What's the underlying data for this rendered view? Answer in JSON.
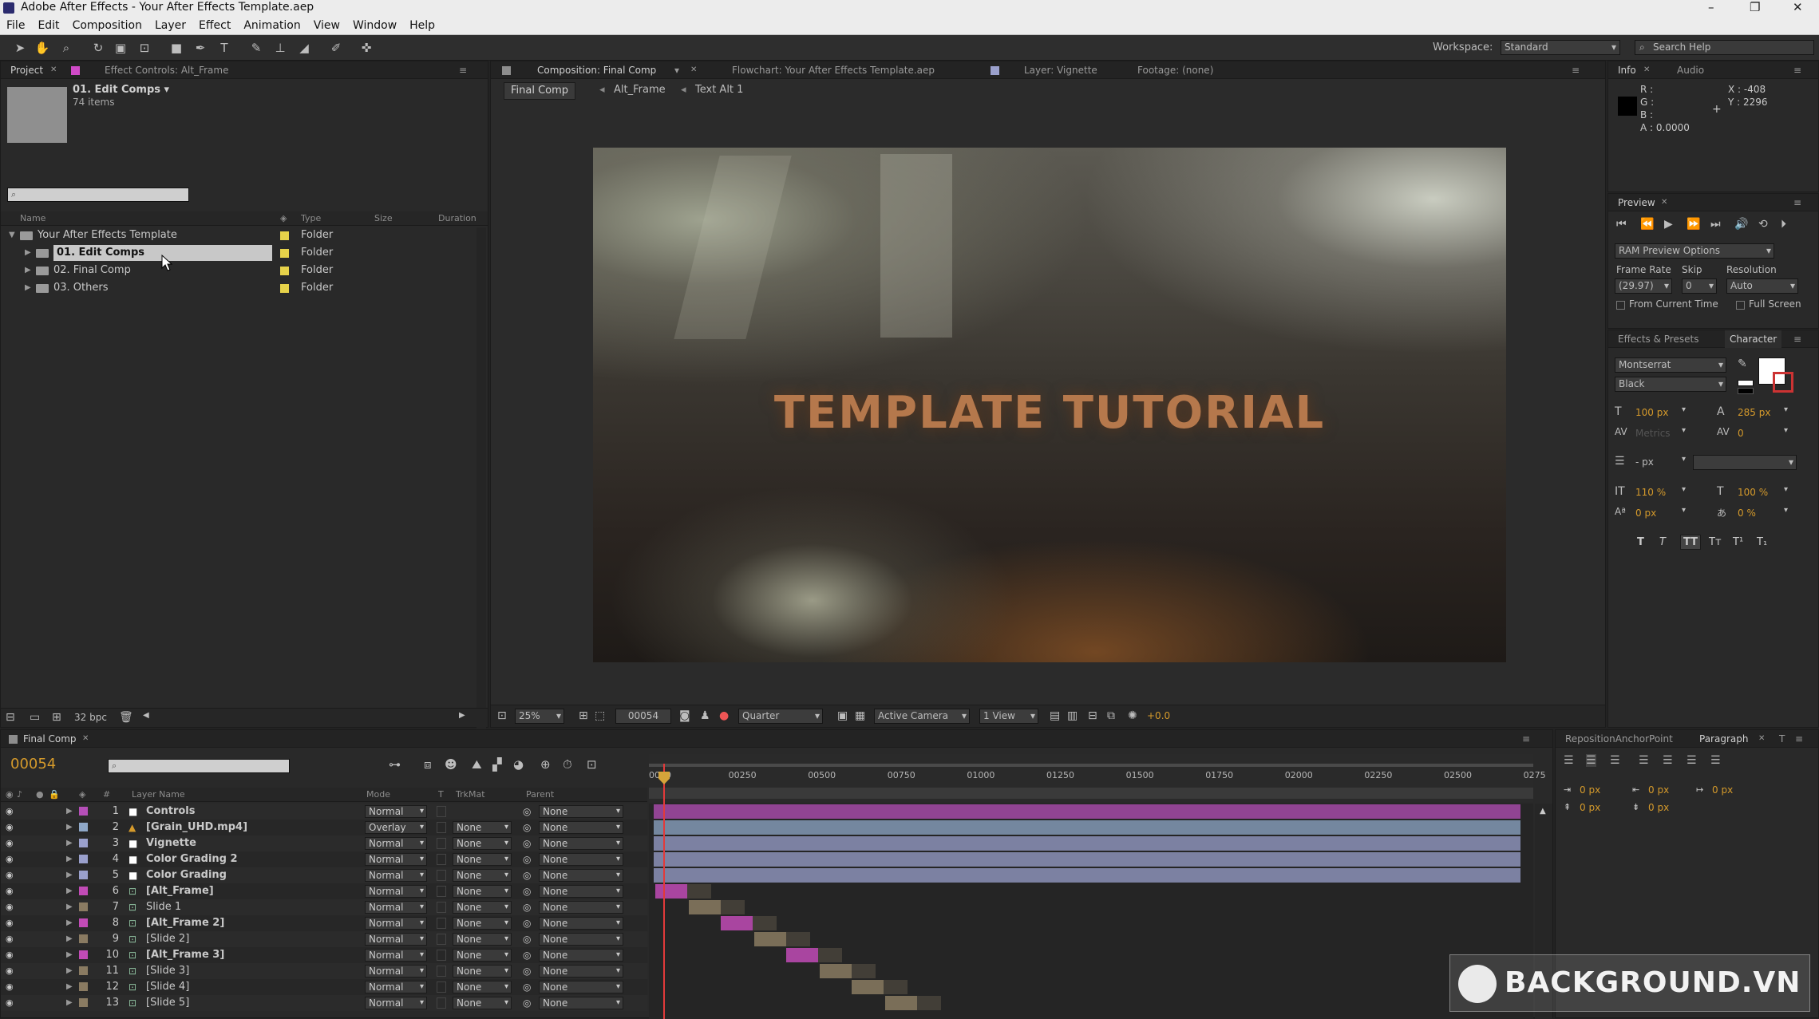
{
  "window": {
    "title": "Adobe After Effects - Your After Effects Template.aep",
    "minimize": "–",
    "maximize": "❐",
    "close": "✕"
  },
  "menu": [
    "File",
    "Edit",
    "Composition",
    "Layer",
    "Effect",
    "Animation",
    "View",
    "Window",
    "Help"
  ],
  "workspace": {
    "label": "Workspace:",
    "value": "Standard",
    "search_placeholder": "Search Help"
  },
  "project_panel": {
    "tab_project": "Project",
    "tab_effect_controls": "Effect Controls: Alt_Frame",
    "selected_name": "01. Edit Comps ▾",
    "selected_count": "74 items",
    "columns": [
      "Name",
      "Type",
      "Size",
      "Duration"
    ],
    "items": [
      {
        "name": "Your After Effects Template",
        "type": "Folder",
        "indent": 0,
        "color": "#e6d24a",
        "open": true
      },
      {
        "name": "01. Edit Comps",
        "type": "Folder",
        "indent": 1,
        "color": "#e6d24a",
        "selected": true
      },
      {
        "name": "02. Final Comp",
        "type": "Folder",
        "indent": 1,
        "color": "#e6d24a"
      },
      {
        "name": "03. Others",
        "type": "Folder",
        "indent": 1,
        "color": "#e6d24a"
      }
    ],
    "bpc": "32 bpc"
  },
  "comp_panel": {
    "tab_comp": "Composition: Final Comp",
    "tab_flowchart": "Flowchart: Your After Effects Template.aep",
    "tab_layer": "Layer: Vignette",
    "tab_footage": "Footage: (none)",
    "breadcrumbs": [
      "Final Comp",
      "Alt_Frame",
      "Text Alt 1"
    ],
    "viewer_title": "TEMPLATE TUTORIAL",
    "zoom": "25%",
    "timecode": "00054",
    "resolution": "Quarter",
    "camera": "Active Camera",
    "views": "1 View",
    "exposure": "+0.0"
  },
  "info_panel": {
    "tab_info": "Info",
    "tab_audio": "Audio",
    "r": "R :",
    "g": "G :",
    "b": "B :",
    "a": "A : 0.0000",
    "x": "X : -408",
    "y": "Y : 2296"
  },
  "preview_panel": {
    "tab": "Preview",
    "ram_options": "RAM Preview Options",
    "frame_rate_label": "Frame Rate",
    "skip_label": "Skip",
    "resolution_label": "Resolution",
    "frame_rate": "(29.97)",
    "skip": "0",
    "resolution": "Auto",
    "from_current": "From Current Time",
    "full_screen": "Full Screen"
  },
  "character_panel": {
    "tab_effects": "Effects & Presets",
    "tab_character": "Character",
    "font": "Montserrat",
    "style": "Black",
    "size": "100 px",
    "leading": "285 px",
    "kerning": "Metrics",
    "tracking": "0",
    "stroke": "- px",
    "vscale": "110 %",
    "hscale": "100 %",
    "baseline": "0 px",
    "tsume": "0 %",
    "styles": [
      "T",
      "T",
      "TT",
      "Tт",
      "T¹",
      "T₁"
    ]
  },
  "paragraph_panel": {
    "tab_reposition": "RepositionAnchorPoint",
    "tab_paragraph": "Paragraph",
    "tab_extra": "T",
    "indent_values": [
      "0 px",
      "0 px",
      "0 px",
      "0 px",
      "0 px"
    ]
  },
  "timeline": {
    "tab": "Final Comp",
    "timecode": "00054",
    "columns": {
      "layer_name": "Layer Name",
      "mode": "Mode",
      "t": "T",
      "trkmat": "TrkMat",
      "parent": "Parent"
    },
    "ruler": [
      "0000",
      "00250",
      "00500",
      "00750",
      "01000",
      "01250",
      "01500",
      "01750",
      "02000",
      "02250",
      "02500",
      "0275"
    ],
    "layers": [
      {
        "num": "1",
        "name": "Controls",
        "mode": "Normal",
        "trkmat": "",
        "parent": "None",
        "color": "#b54fb8",
        "icon": "solid"
      },
      {
        "num": "2",
        "name": "[Grain_UHD.mp4]",
        "mode": "Overlay",
        "trkmat": "None",
        "parent": "None",
        "color": "#8fa8c8",
        "icon": "footage"
      },
      {
        "num": "3",
        "name": "Vignette",
        "mode": "Normal",
        "trkmat": "None",
        "parent": "None",
        "color": "#9aa0cc",
        "icon": "solid"
      },
      {
        "num": "4",
        "name": "Color Grading 2",
        "mode": "Normal",
        "trkmat": "None",
        "parent": "None",
        "color": "#9aa0cc",
        "icon": "solid"
      },
      {
        "num": "5",
        "name": "Color Grading",
        "mode": "Normal",
        "trkmat": "None",
        "parent": "None",
        "color": "#9aa0cc",
        "icon": "solid"
      },
      {
        "num": "6",
        "name": "[Alt_Frame]",
        "mode": "Normal",
        "trkmat": "None",
        "parent": "None",
        "color": "#c14bb6",
        "icon": "comp"
      },
      {
        "num": "7",
        "name": "Slide 1",
        "mode": "Normal",
        "trkmat": "None",
        "parent": "None",
        "color": "#8a7b62",
        "icon": "comp"
      },
      {
        "num": "8",
        "name": "[Alt_Frame 2]",
        "mode": "Normal",
        "trkmat": "None",
        "parent": "None",
        "color": "#c14bb6",
        "icon": "comp"
      },
      {
        "num": "9",
        "name": "[Slide 2]",
        "mode": "Normal",
        "trkmat": "None",
        "parent": "None",
        "color": "#8a7b62",
        "icon": "comp"
      },
      {
        "num": "10",
        "name": "[Alt_Frame 3]",
        "mode": "Normal",
        "trkmat": "None",
        "parent": "None",
        "color": "#c14bb6",
        "icon": "comp"
      },
      {
        "num": "11",
        "name": "[Slide 3]",
        "mode": "Normal",
        "trkmat": "None",
        "parent": "None",
        "color": "#8a7b62",
        "icon": "comp"
      },
      {
        "num": "12",
        "name": "[Slide 4]",
        "mode": "Normal",
        "trkmat": "None",
        "parent": "None",
        "color": "#8a7b62",
        "icon": "comp"
      },
      {
        "num": "13",
        "name": "[Slide 5]",
        "mode": "Normal",
        "trkmat": "None",
        "parent": "None",
        "color": "#8a7b62",
        "icon": "comp"
      }
    ]
  },
  "watermark": "BACKGROUND.VN"
}
